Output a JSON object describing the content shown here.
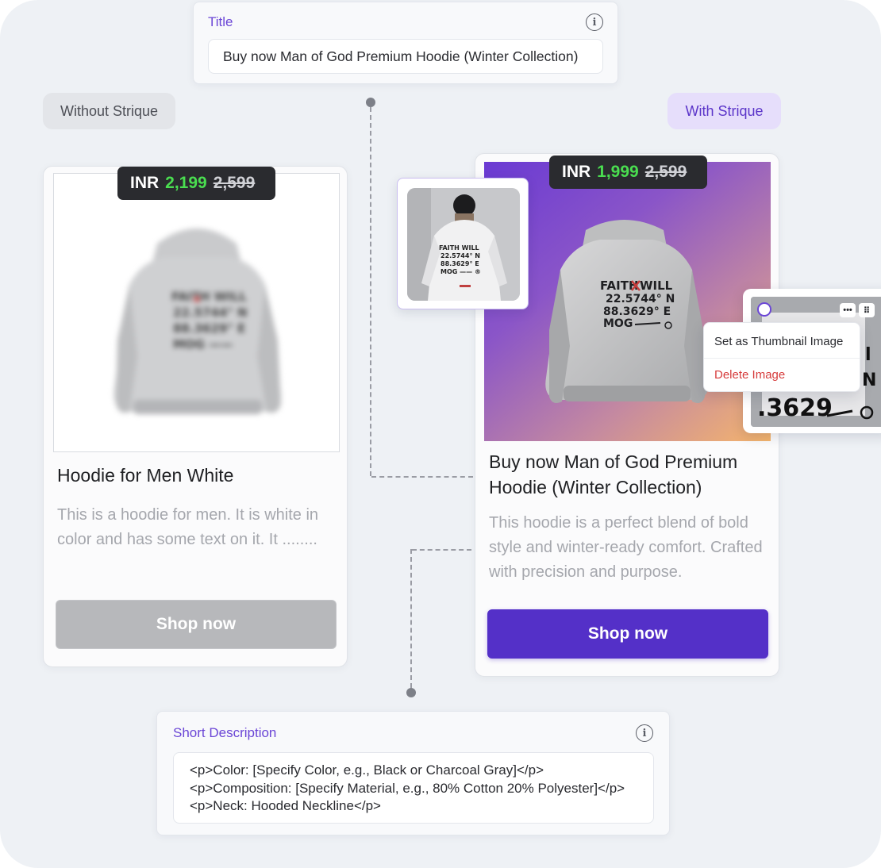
{
  "title_panel": {
    "label": "Title",
    "value": "Buy now Man of God Premium Hoodie (Winter Collection)"
  },
  "pills": {
    "without": "Without Strique",
    "with": "With Strique"
  },
  "left_card": {
    "currency": "INR",
    "price": "2,199",
    "old_price": "2,599",
    "name": "Hoodie for Men White",
    "description": "This is a hoodie for men. It is white in color and has some text on it. It ........",
    "button_label": "Shop now"
  },
  "right_card": {
    "currency": "INR",
    "price": "1,999",
    "old_price": "2,599",
    "name": "Buy now Man of God Premium Hoodie (Winter Collection)",
    "description": "This hoodie is a perfect blend of bold style and winter-ready comfort. Crafted with precision and purpose.",
    "button_label": "Shop now"
  },
  "hoodie_print": {
    "line1": "FAITH",
    "line1b": "WILL",
    "line2": "22.5744° N",
    "line3": "88.3629° E",
    "line4": "MOG"
  },
  "context_menu": {
    "set_thumbnail": "Set as Thumbnail Image",
    "delete": "Delete Image",
    "more_icon": "•••",
    "drag_icon": "⠿"
  },
  "short_description_panel": {
    "label": "Short Description",
    "value": "<p>Color: [Specify Color, e.g., Black or Charcoal Gray]</p> <p>Composition: [Specify Material, e.g., 80% Cotton 20% Polyester]</p> <p>Neck: Hooded Neckline</p>"
  },
  "icons": {
    "info": "i"
  },
  "colors": {
    "accent": "#6b46d6",
    "primary_button": "#5430c8",
    "disabled_button": "#b7b8bb",
    "price_green": "#4ade50",
    "delete_red": "#d63b3b",
    "badge_bg": "#2a2b2f"
  }
}
